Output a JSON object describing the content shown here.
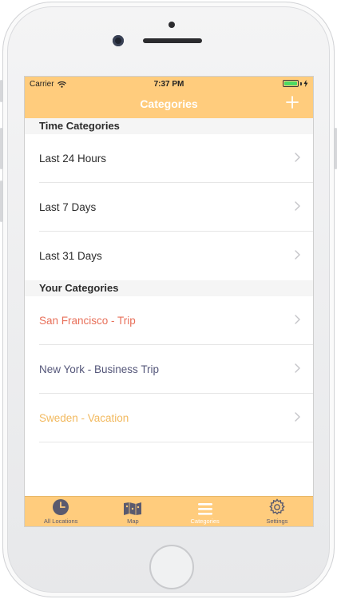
{
  "status_bar": {
    "carrier": "Carrier",
    "time": "7:37 PM"
  },
  "nav": {
    "title": "Categories",
    "add_icon": "plus-icon"
  },
  "sections": [
    {
      "title": "Time Categories",
      "items": [
        {
          "label": "Last 24 Hours",
          "color": "#2c2c2c"
        },
        {
          "label": "Last 7 Days",
          "color": "#2c2c2c"
        },
        {
          "label": "Last 31 Days",
          "color": "#2c2c2c"
        }
      ]
    },
    {
      "title": "Your Categories",
      "items": [
        {
          "label": "San Francisco - Trip",
          "color": "#e8705a"
        },
        {
          "label": "New York - Business Trip",
          "color": "#55577a"
        },
        {
          "label": "Sweden - Vacation",
          "color": "#f2b95e"
        }
      ]
    }
  ],
  "tabs": [
    {
      "label": "All Locations",
      "icon": "clock-icon",
      "active": false
    },
    {
      "label": "Map",
      "icon": "map-icon",
      "active": false
    },
    {
      "label": "Categories",
      "icon": "list-icon",
      "active": true
    },
    {
      "label": "Settings",
      "icon": "gear-icon",
      "active": false
    }
  ],
  "colors": {
    "accent": "#ffcc7d",
    "tab_inactive": "#5a5a6e",
    "tab_active": "#ffffff"
  }
}
